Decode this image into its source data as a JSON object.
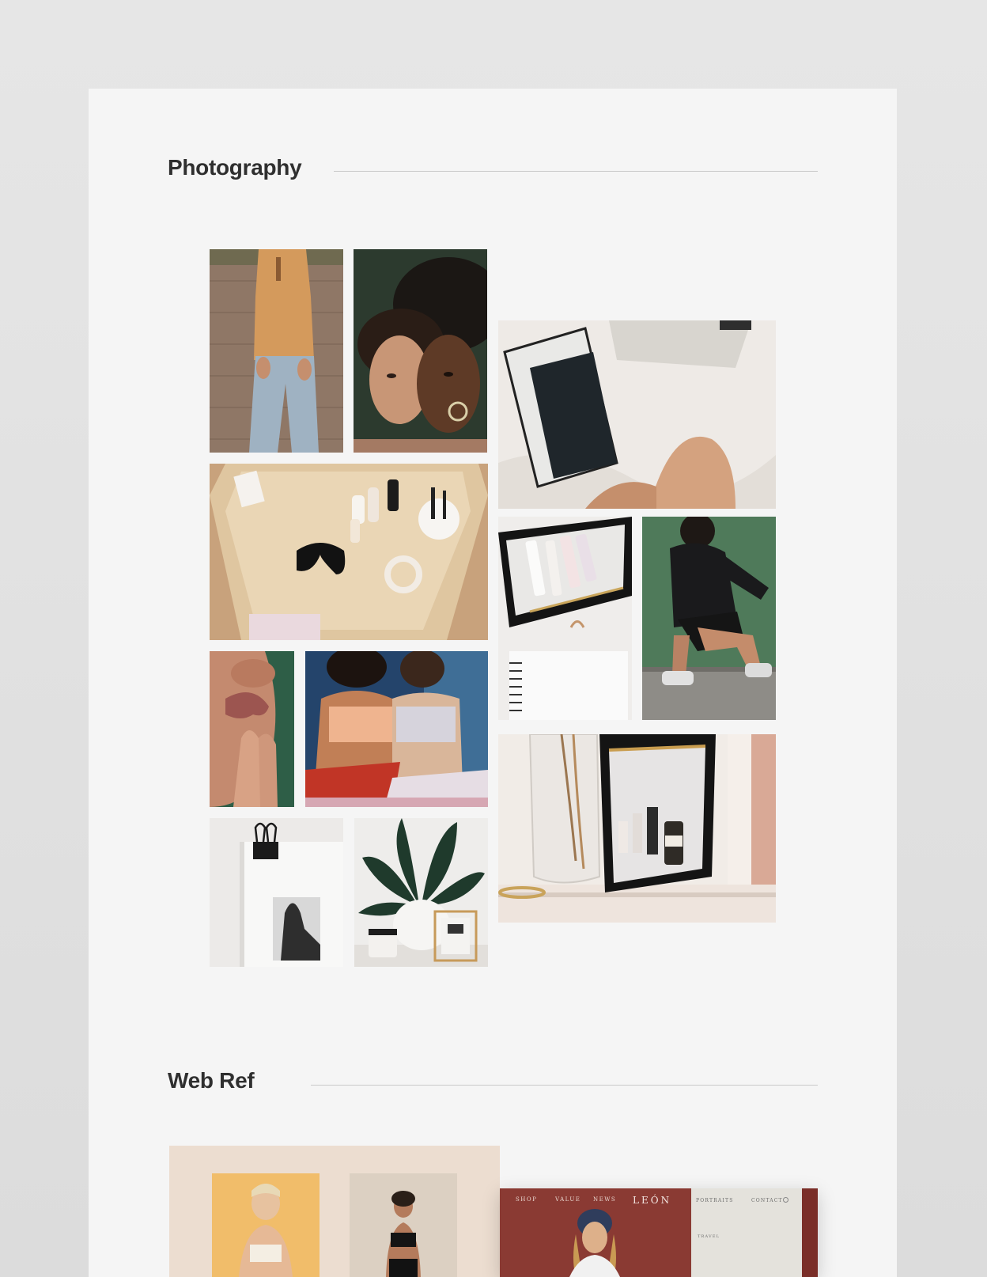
{
  "sections": {
    "photography": {
      "title": "Photography"
    },
    "webref": {
      "title": "Web Ref"
    }
  },
  "photos": [
    {
      "name": "photo-woman-tan-top-jeans",
      "subject": "woman in tan ribbed top and light jeans against brick wall"
    },
    {
      "name": "photo-two-women-portrait",
      "subject": "close-up portrait of two women with curly hair, dark green background"
    },
    {
      "name": "photo-notebook-in-pouch",
      "subject": "black notebook in clear pouch on white bedding beside laptop"
    },
    {
      "name": "photo-vanity-tray-flatlay",
      "subject": "wooden tray with sunglasses, serum bottles and scrunchie"
    },
    {
      "name": "photo-skincare-pouch-notebook",
      "subject": "skincare tubes in black zip pouch above spiral notebook"
    },
    {
      "name": "photo-woman-leather-jacket",
      "subject": "woman in black leather jacket crouching against green wall"
    },
    {
      "name": "photo-lips-closeup",
      "subject": "close-up of lips and fingers, green background"
    },
    {
      "name": "photo-two-women-seated",
      "subject": "two women in tube tops seated together"
    },
    {
      "name": "photo-pouch-on-windowsill",
      "subject": "clear pouch with serum bottles beside vase on windowsill"
    },
    {
      "name": "photo-magazine-clip",
      "subject": "magazine page held by binder clip"
    },
    {
      "name": "photo-plant-and-frame",
      "subject": "potted plant with candle and small frame"
    }
  ],
  "webref": {
    "site_nav": [
      "SHOP",
      "VALUE",
      "NEWS"
    ],
    "site_logo": "LEÓN",
    "side_nav": [
      "PORTRAITS",
      "CONTACT"
    ],
    "side_sub": "TRAVEL"
  },
  "colors": {
    "board": "#f5f5f5",
    "page_bg": "#e3e3e3",
    "title": "#2f2f2f",
    "rule": "#c9c9c9",
    "webref_card_bg": "#ecddd0",
    "webref_site_bg": "#8a3a33"
  }
}
